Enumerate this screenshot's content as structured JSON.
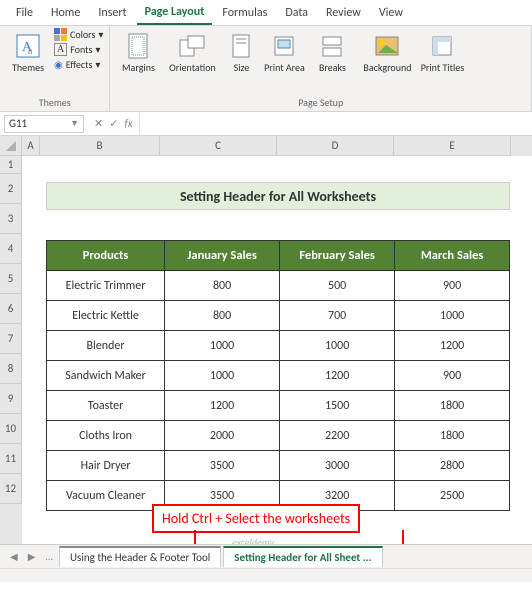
{
  "ribbon": {
    "tabs": [
      "File",
      "Home",
      "Insert",
      "Page Layout",
      "Formulas",
      "Data",
      "Review",
      "View"
    ],
    "active_tab": "Page Layout",
    "themes": {
      "themes_label": "Themes",
      "colors_label": "Colors",
      "fonts_label": "Fonts",
      "effects_label": "Effects",
      "group_label": "Themes"
    },
    "page_setup": {
      "margins": "Margins",
      "orientation": "Orientation",
      "size": "Size",
      "print_area": "Print\nArea",
      "breaks": "Breaks",
      "background": "Background",
      "print_titles": "Print\nTitles",
      "group_label": "Page Setup"
    }
  },
  "name_box": {
    "value": "G11"
  },
  "formula_bar": {
    "fx": "fx",
    "value": ""
  },
  "columns": [
    "A",
    "B",
    "C",
    "D",
    "E"
  ],
  "rows": [
    "1",
    "2",
    "3",
    "4",
    "5",
    "6",
    "7",
    "8",
    "9",
    "10",
    "11",
    "12"
  ],
  "title": "Setting Header for All Worksheets",
  "table": {
    "headers": [
      "Products",
      "January Sales",
      "February Sales",
      "March Sales"
    ],
    "rows": [
      [
        "Electric Trimmer",
        "800",
        "500",
        "900"
      ],
      [
        "Electric Kettle",
        "800",
        "700",
        "1000"
      ],
      [
        "Blender",
        "1000",
        "1000",
        "1200"
      ],
      [
        "Sandwich Maker",
        "1000",
        "1200",
        "900"
      ],
      [
        "Toaster",
        "1200",
        "1500",
        "1800"
      ],
      [
        "Cloths Iron",
        "2000",
        "2200",
        "1800"
      ],
      [
        "Hair Dryer",
        "3500",
        "3000",
        "2800"
      ],
      [
        "Vacuum Cleaner",
        "3500",
        "3200",
        "2500"
      ]
    ]
  },
  "annotation": "Hold Ctrl + Select the worksheets",
  "watermark": "exceldemy",
  "sheet_tabs": {
    "tab1": "Using the Header & Footer Tool",
    "tab2": "Setting Header for All Sheet",
    "ellipsis": "..."
  },
  "colors": {
    "accent": "#217346",
    "table_header": "#548235",
    "title_bg": "#e2efda",
    "annotation": "#ff0000"
  }
}
